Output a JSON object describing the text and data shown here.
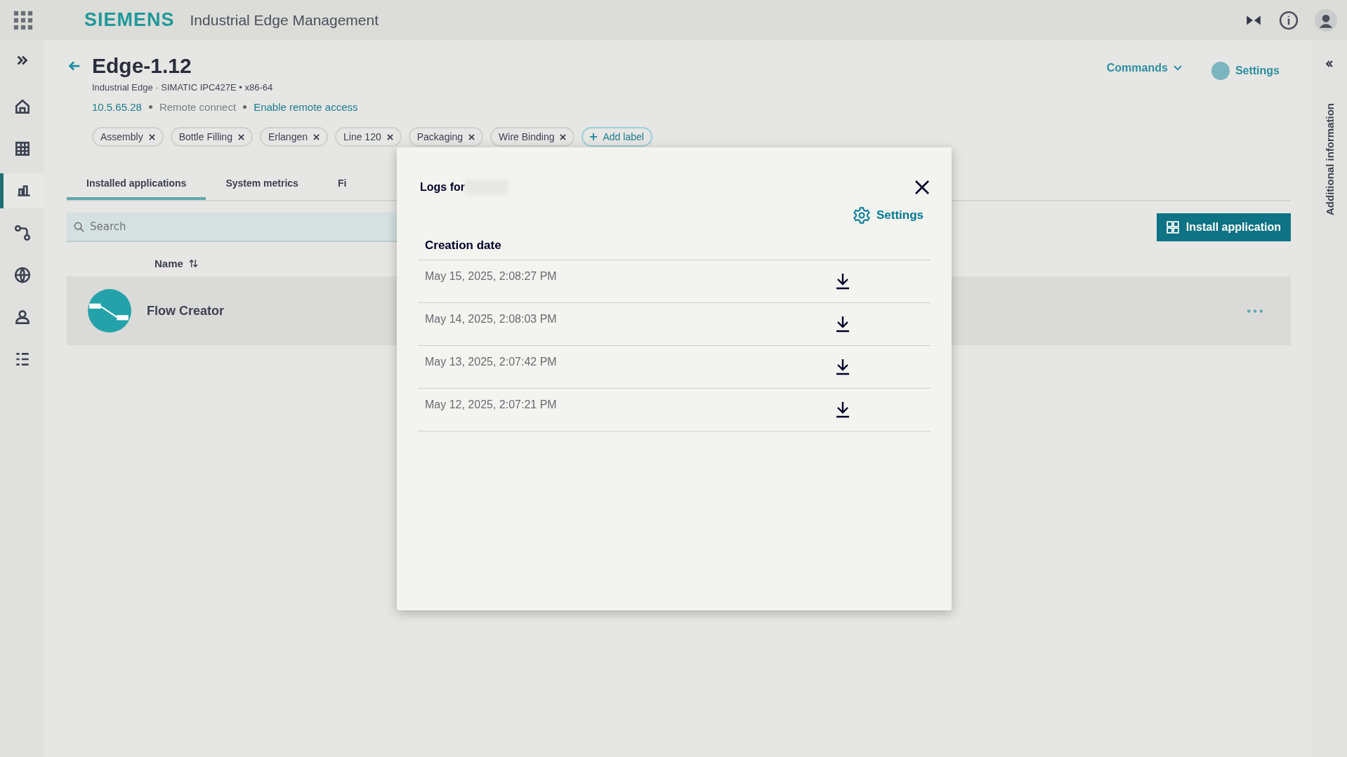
{
  "header": {
    "logo": "SIEMENS",
    "title": "Industrial Edge Management"
  },
  "sidebar": {
    "items": [
      {
        "selected": false
      },
      {
        "selected": false
      },
      {
        "selected": true
      },
      {
        "selected": false
      },
      {
        "selected": false
      },
      {
        "selected": false
      },
      {
        "selected": false
      }
    ]
  },
  "device": {
    "name": "Edge-1.12",
    "subtitle": "Industrial Edge · SIMATIC IPC427E • x86-64",
    "ip": "10.5.65.28",
    "remote": "Remote connect",
    "enable_link": "Enable remote access",
    "commands": "Commands",
    "settings": "Settings"
  },
  "labels": [
    "Assembly",
    "Bottle Filling",
    "Erlangen",
    "Line 120",
    "Packaging",
    "Wire Binding"
  ],
  "add_label": "Add label",
  "tabs": [
    {
      "label": "Installed applications",
      "selected": true
    },
    {
      "label": "System metrics",
      "selected": false
    },
    {
      "label": "Fi",
      "selected": false
    }
  ],
  "search": {
    "placeholder": "Search"
  },
  "install_button": "Install application",
  "table": {
    "columns": [
      "Name"
    ],
    "rows": [
      {
        "name": "Flow Creator"
      }
    ]
  },
  "side_panel": {
    "title": "Additional information"
  },
  "dialog": {
    "title": "Logs for",
    "settings": "Settings",
    "column": "Creation date",
    "rows": [
      {
        "date": "May 15, 2025, 2:08:27 PM"
      },
      {
        "date": "May 14, 2025, 2:08:03 PM"
      },
      {
        "date": "May 13, 2025, 2:07:42 PM"
      },
      {
        "date": "May 12, 2025, 2:07:21 PM"
      }
    ]
  }
}
